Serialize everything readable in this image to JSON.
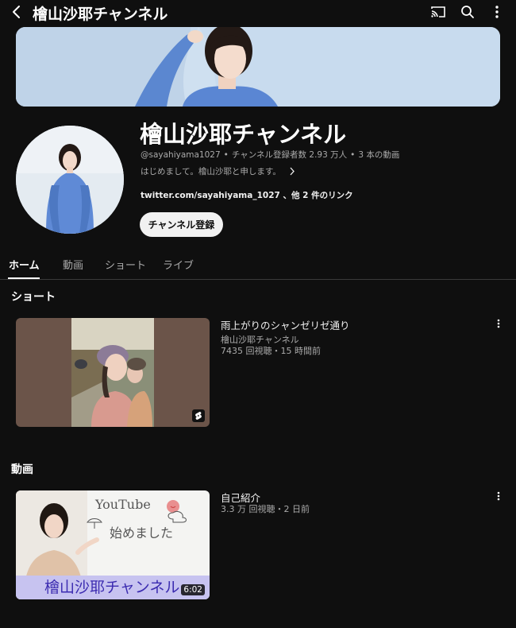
{
  "header": {
    "title": "檜山沙耶チャンネル",
    "icons": [
      "back-icon",
      "cast-icon",
      "search-icon",
      "more-icon"
    ]
  },
  "channel": {
    "name": "檜山沙耶チャンネル",
    "handle": "@sayahiyama1027",
    "subscribers": "チャンネル登録者数 2.93 万人",
    "video_count": "3 本の動画",
    "separator": "•",
    "description": "はじめまして。檜山沙耶と申します。",
    "links": "twitter.com/sayahiyama_1027 、他 2 件のリンク",
    "subscribe_label": "チャンネル登録"
  },
  "tabs": [
    {
      "label": "ホーム",
      "active": true
    },
    {
      "label": "動画",
      "active": false
    },
    {
      "label": "ショート",
      "active": false
    },
    {
      "label": "ライブ",
      "active": false
    }
  ],
  "shorts_section": {
    "title": "ショート",
    "items": [
      {
        "title": "雨上がりのシャンゼリゼ通り",
        "channel": "檜山沙耶チャンネル",
        "stats": "7435 回視聴・15 時間前",
        "badge_icon": "shorts-icon"
      }
    ]
  },
  "videos_section": {
    "title": "動画",
    "items": [
      {
        "title": "自己紹介",
        "stats": "3.3 万 回視聴・2 日前",
        "duration": "6:02",
        "thumb_caption": "檜山沙耶チャンネル",
        "thumb_whiteboard_line1": "YouTube",
        "thumb_whiteboard_line2": "始めました"
      }
    ]
  },
  "colors": {
    "background": "#0f0f0f",
    "text_primary": "#f1f1f1",
    "text_secondary": "#aaaaaa",
    "subscribe_bg": "#f1f1f1",
    "banner_bg": "#c3d7ea"
  }
}
